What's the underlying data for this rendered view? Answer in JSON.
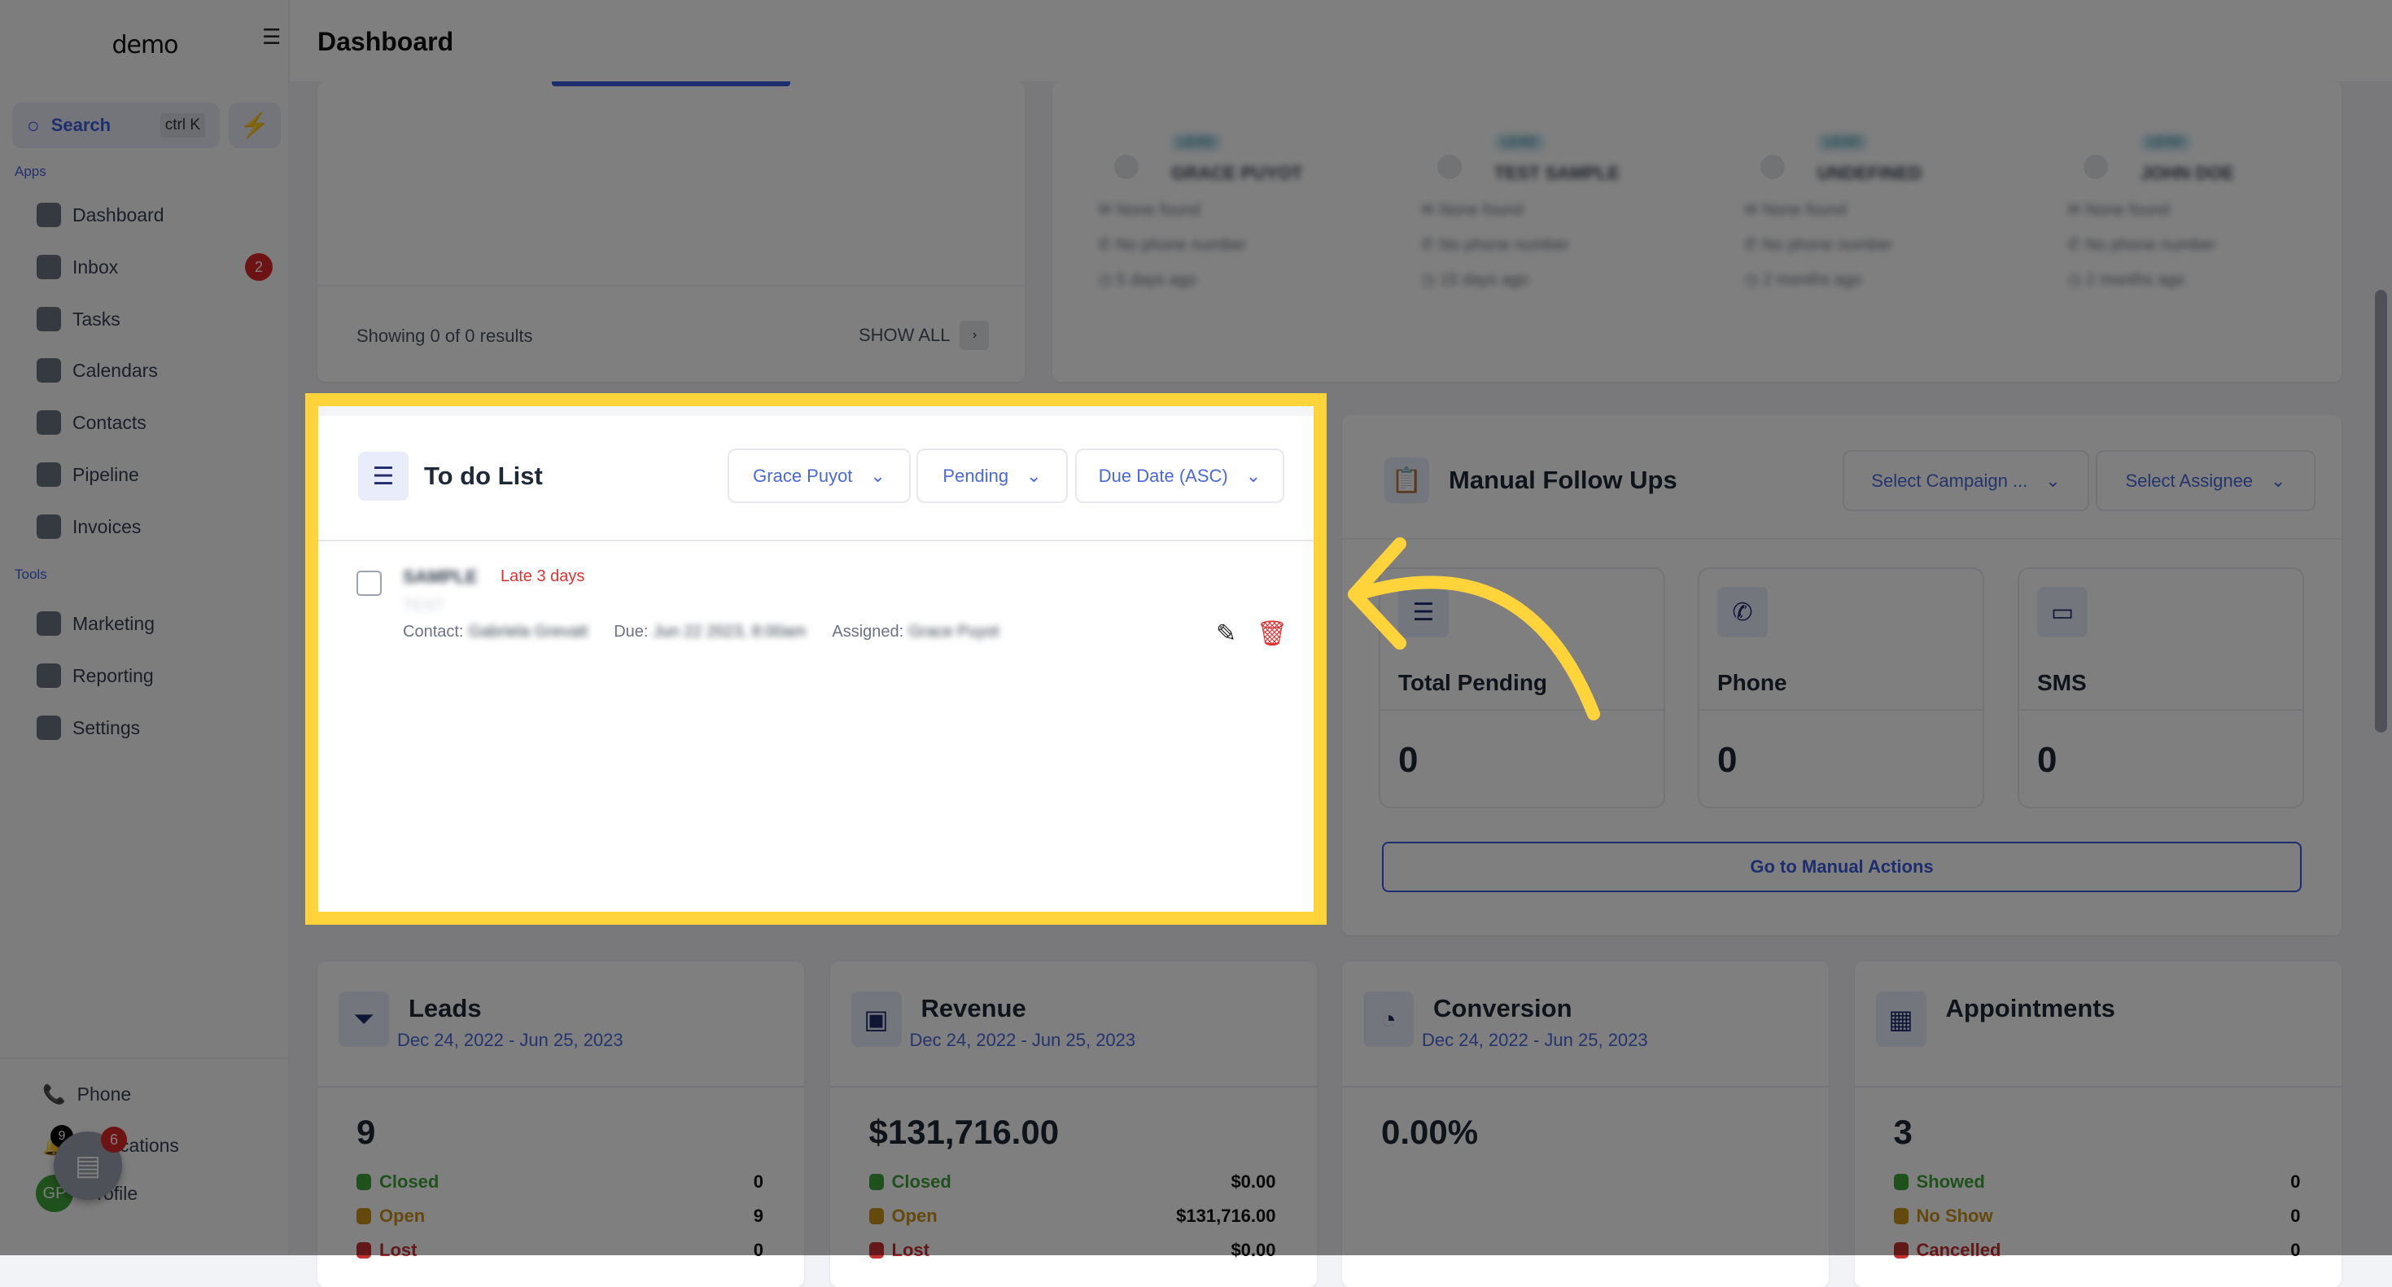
{
  "app": {
    "logo": "demo",
    "page_title": "Dashboard"
  },
  "sidebar": {
    "search_label": "Search",
    "search_shortcut": "ctrl K",
    "apps_label": "Apps",
    "tools_label": "Tools",
    "apps": [
      {
        "label": "Dashboard",
        "icon": "dashboard-icon"
      },
      {
        "label": "Inbox",
        "icon": "inbox-icon",
        "badge": "2"
      },
      {
        "label": "Tasks",
        "icon": "tasks-icon"
      },
      {
        "label": "Calendars",
        "icon": "calendar-icon"
      },
      {
        "label": "Contacts",
        "icon": "contacts-icon"
      },
      {
        "label": "Pipeline",
        "icon": "pipeline-icon"
      },
      {
        "label": "Invoices",
        "icon": "invoice-icon"
      }
    ],
    "tools": [
      {
        "label": "Marketing",
        "icon": "megaphone-icon"
      },
      {
        "label": "Reporting",
        "icon": "chart-icon"
      },
      {
        "label": "Settings",
        "icon": "gear-icon"
      }
    ],
    "bottom": [
      {
        "label": "Phone"
      },
      {
        "label": "Notifications",
        "badge": "9"
      },
      {
        "label": "Profile",
        "avatar": "GP"
      }
    ],
    "chat_badge": "6"
  },
  "top_left": {
    "showing": "Showing 0 of 0 results",
    "show_all": "SHOW ALL"
  },
  "contacts": [
    {
      "tag": "LEAD",
      "name": "GRACE PUYOT",
      "email": "None found",
      "phone": "No phone number",
      "time": "5 days ago"
    },
    {
      "tag": "LEAD",
      "name": "TEST SAMPLE",
      "email": "None found",
      "phone": "No phone number",
      "time": "15 days ago"
    },
    {
      "tag": "LEAD",
      "name": "UNDEFINED",
      "email": "None found",
      "phone": "No phone number",
      "time": "2 months ago"
    },
    {
      "tag": "LEAD",
      "name": "JOHN DOE",
      "email": "None found",
      "phone": "No phone number",
      "time": "2 months ago"
    }
  ],
  "todo": {
    "title": "To do List",
    "filters": [
      "Grace Puyot",
      "Pending",
      "Due Date (ASC)"
    ],
    "task": {
      "title": "SAMPLE",
      "late": "Late 3 days",
      "desc": "TEST",
      "contact_label": "Contact:",
      "contact": "Gabriela Grevatt",
      "due_label": "Due:",
      "due": "Jun 22 2023, 8:00am",
      "assigned_label": "Assigned:",
      "assigned": "Grace Puyot"
    }
  },
  "followups": {
    "title": "Manual Follow Ups",
    "campaign": "Select Campaign ...",
    "assignee": "Select Assignee",
    "stats": [
      {
        "label": "Total Pending",
        "value": "0"
      },
      {
        "label": "Phone",
        "value": "0"
      },
      {
        "label": "SMS",
        "value": "0"
      }
    ],
    "button": "Go to Manual Actions"
  },
  "metrics": [
    {
      "title": "Leads",
      "date": "Dec 24, 2022 - Jun 25, 2023",
      "value": "9",
      "rows": [
        {
          "label": "Closed",
          "value": "0"
        },
        {
          "label": "Open",
          "value": "9"
        },
        {
          "label": "Lost",
          "value": "0"
        }
      ]
    },
    {
      "title": "Revenue",
      "date": "Dec 24, 2022 - Jun 25, 2023",
      "value": "$131,716.00",
      "rows": [
        {
          "label": "Closed",
          "value": "$0.00"
        },
        {
          "label": "Open",
          "value": "$131,716.00"
        },
        {
          "label": "Lost",
          "value": "$0.00"
        }
      ]
    },
    {
      "title": "Conversion",
      "date": "Dec 24, 2022 - Jun 25, 2023",
      "value": "0.00%",
      "rows": []
    },
    {
      "title": "Appointments",
      "date": "",
      "value": "3",
      "rows": [
        {
          "label": "Showed",
          "value": "0"
        },
        {
          "label": "No Show",
          "value": "0"
        },
        {
          "label": "Cancelled",
          "value": "0"
        }
      ]
    }
  ],
  "colors": {
    "highlight": "#ffd43b",
    "accent": "#4a68d8",
    "green": "#3fa33a",
    "amber": "#c9921b",
    "red": "#c53030",
    "late": "#e03131"
  }
}
